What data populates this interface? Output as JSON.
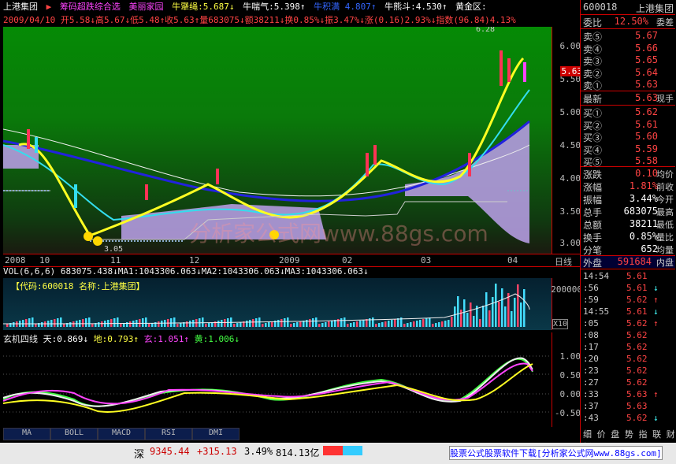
{
  "header": {
    "stock_name": "上港集团",
    "arrow": "▶",
    "formula_name": "筹码超跌综合选",
    "formula_sub": "美丽家园",
    "indicators": [
      {
        "label": "牛犟绳:5.687↓",
        "color": "#ffff44"
      },
      {
        "label": "牛喘气:5.398↑",
        "color": "#ffffff"
      },
      {
        "label": "牛积满 4.807↑",
        "color": "#3366ff"
      },
      {
        "label": "牛熊斗:4.530↑",
        "color": "#ffffff"
      },
      {
        "label": "黄金区:",
        "color": "#ffffff"
      }
    ],
    "info": "2009/04/10 开5.58↓高5.67↓低5.48↑收5.63↑量683075↓额38211↓换0.85%↓振3.47%↓涨(0.16)2.93%↓指数(96.84)4.13%"
  },
  "price_axis": {
    "ticks": [
      "6.00",
      "5.50",
      "5.00",
      "4.50",
      "4.00",
      "3.50",
      "3.00"
    ],
    "current_price": "5.63",
    "high_label": "6.28",
    "low_label": "3.05"
  },
  "date_axis": {
    "labels": [
      "2008",
      "10",
      "11",
      "12",
      "2009",
      "02",
      "03",
      "04"
    ],
    "mode": "日线"
  },
  "volume": {
    "header": "VOL(6,6,6) 683075.438↓MA1:1043306.063↓MA2:1043306.063↓MA3:1043306.063↓",
    "code_label": "【代码:600018  名称:上港集团】",
    "axis_label": "200000",
    "unit": "X10"
  },
  "indicator": {
    "name": "玄机四线",
    "values": [
      {
        "label": "天:0.869↓",
        "color": "#ffffff"
      },
      {
        "label": "地:0.793↑",
        "color": "#ffff44"
      },
      {
        "label": "玄:1.051↑",
        "color": "#ff44ff"
      },
      {
        "label": "黄:1.006↓",
        "color": "#44ff44"
      }
    ],
    "ticks": [
      "1.00",
      "0.50",
      "0.00",
      "-0.50"
    ]
  },
  "tabs": [
    "MA",
    "BOLL",
    "MACD",
    "RSI",
    "DMI"
  ],
  "side": {
    "code": "600018",
    "name": "上港集团",
    "weibi_label": "委比",
    "weibi": "12.50%",
    "weicha": "委差",
    "sells": [
      {
        "label": "卖⑤",
        "price": "5.67"
      },
      {
        "label": "卖④",
        "price": "5.66"
      },
      {
        "label": "卖③",
        "price": "5.65"
      },
      {
        "label": "卖②",
        "price": "5.64"
      },
      {
        "label": "卖①",
        "price": "5.63"
      }
    ],
    "latest_label": "最新",
    "latest": "5.63",
    "latest_right": "现手",
    "buys": [
      {
        "label": "买①",
        "price": "5.62"
      },
      {
        "label": "买②",
        "price": "5.61"
      },
      {
        "label": "买③",
        "price": "5.60"
      },
      {
        "label": "买④",
        "price": "5.59"
      },
      {
        "label": "买⑤",
        "price": "5.58"
      }
    ],
    "stats": [
      {
        "label": "涨跌",
        "value": "0.10",
        "right": "均价",
        "color": "#ff4444"
      },
      {
        "label": "涨幅",
        "value": "1.81%",
        "right": "前收",
        "color": "#ff4444"
      },
      {
        "label": "振幅",
        "value": "3.44%",
        "right": "今开",
        "color": "#ffffff"
      },
      {
        "label": "总手",
        "value": "683075",
        "right": "最高",
        "color": "#ffffff"
      },
      {
        "label": "总额",
        "value": "38211",
        "right": "最低",
        "color": "#ffffff"
      },
      {
        "label": "换手",
        "value": "0.85%",
        "right": "量比",
        "color": "#ffffff"
      },
      {
        "label": "分笔",
        "value": "652",
        "right": "均量",
        "color": "#ffffff"
      }
    ],
    "outer_label": "外盘",
    "outer": "591684",
    "inner_label": "内盘",
    "ticks": [
      {
        "time": "14:54",
        "price": "5.61",
        "arrow": ""
      },
      {
        "time": ":56",
        "price": "5.61",
        "arrow": "↓"
      },
      {
        "time": ":59",
        "price": "5.62",
        "arrow": "↑"
      },
      {
        "time": "14:55",
        "price": "5.61",
        "arrow": "↓"
      },
      {
        "time": ":05",
        "price": "5.62",
        "arrow": "↑"
      },
      {
        "time": ":08",
        "price": "5.62",
        "arrow": ""
      },
      {
        "time": ":17",
        "price": "5.62",
        "arrow": ""
      },
      {
        "time": ":20",
        "price": "5.62",
        "arrow": ""
      },
      {
        "time": ":23",
        "price": "5.62",
        "arrow": ""
      },
      {
        "time": ":27",
        "price": "5.62",
        "arrow": ""
      },
      {
        "time": ":33",
        "price": "5.63",
        "arrow": "↑"
      },
      {
        "time": ":37",
        "price": "5.63",
        "arrow": ""
      },
      {
        "time": ":43",
        "price": "5.62",
        "arrow": "↓"
      }
    ],
    "bottom_tabs": "细 价 盘 势 指 联 财 析"
  },
  "status": {
    "market": "深",
    "index": "9345.44",
    "change": "+315.13",
    "pct": "3.49%",
    "amount": "814.13亿",
    "ad": "股票公式股票软件下载[分析家公式网www.88gs.com]"
  },
  "watermark": "分析家公式网www.88gs.com",
  "colors": {
    "up": "#ff4444",
    "down": "#44ffff",
    "panel_border": "#cc0000"
  }
}
